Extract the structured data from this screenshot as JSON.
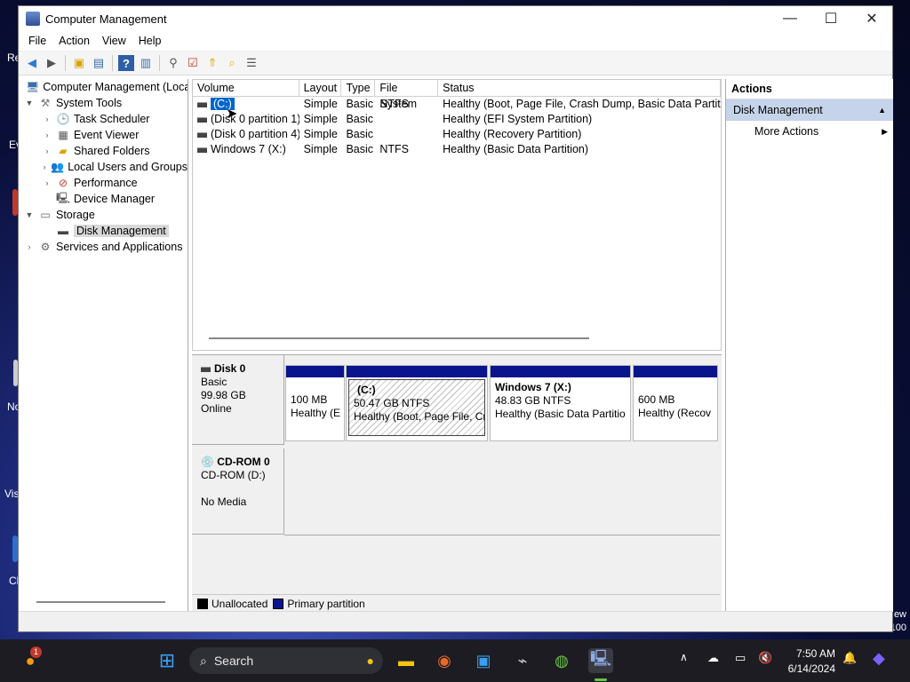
{
  "window": {
    "title": "Computer Management",
    "controls": {
      "minimize": "—",
      "maximize": "☐",
      "close": "✕"
    }
  },
  "menu": [
    "File",
    "Action",
    "View",
    "Help"
  ],
  "tree": {
    "root": "Computer Management (Local",
    "system_tools": "System Tools",
    "task_scheduler": "Task Scheduler",
    "event_viewer": "Event Viewer",
    "shared_folders": "Shared Folders",
    "local_users": "Local Users and Groups",
    "performance": "Performance",
    "device_manager": "Device Manager",
    "storage": "Storage",
    "disk_management": "Disk Management",
    "services": "Services and Applications"
  },
  "volume_list": {
    "headers": [
      "Volume",
      "Layout",
      "Type",
      "File System",
      "Status"
    ],
    "rows": [
      {
        "volume": "(C:)",
        "layout": "Simple",
        "type": "Basic",
        "fs": "NTFS",
        "status": "Healthy (Boot, Page File, Crash Dump, Basic Data Partition)"
      },
      {
        "volume": "(Disk 0 partition 1)",
        "layout": "Simple",
        "type": "Basic",
        "fs": "",
        "status": "Healthy (EFI System Partition)"
      },
      {
        "volume": "(Disk 0 partition 4)",
        "layout": "Simple",
        "type": "Basic",
        "fs": "",
        "status": "Healthy (Recovery Partition)"
      },
      {
        "volume": "Windows 7 (X:)",
        "layout": "Simple",
        "type": "Basic",
        "fs": "NTFS",
        "status": "Healthy (Basic Data Partition)"
      }
    ]
  },
  "disks": {
    "disk0": {
      "name": "Disk 0",
      "type": "Basic",
      "size": "99.98 GB",
      "state": "Online"
    },
    "cdrom0": {
      "name": "CD-ROM 0",
      "type": "CD-ROM (D:)",
      "state": "No Media"
    }
  },
  "partitions": [
    {
      "title": "",
      "size": "100 MB",
      "status": "Healthy (E"
    },
    {
      "title": "(C:)",
      "size": "50.47 GB NTFS",
      "status": "Healthy (Boot, Page File, Cr"
    },
    {
      "title": "Windows 7  (X:)",
      "size": "48.83 GB NTFS",
      "status": "Healthy (Basic Data Partitio"
    },
    {
      "title": "",
      "size": "600 MB",
      "status": "Healthy (Recov"
    }
  ],
  "legend": {
    "unallocated": "Unallocated",
    "primary": "Primary partition",
    "unallocated_color": "#000000",
    "primary_color": "#0a148c"
  },
  "actions": {
    "header": "Actions",
    "section": "Disk Management",
    "more": "More Actions"
  },
  "taskbar": {
    "search": "Search",
    "time": "7:50 AM",
    "date": "6/14/2024",
    "badge": "1"
  },
  "desktop_fragments": {
    "re": "Re",
    "ev": "Ev",
    "no": "No",
    "vis": "Vis",
    "cl": "Cl",
    "ew": "ew",
    "n100": "100"
  }
}
